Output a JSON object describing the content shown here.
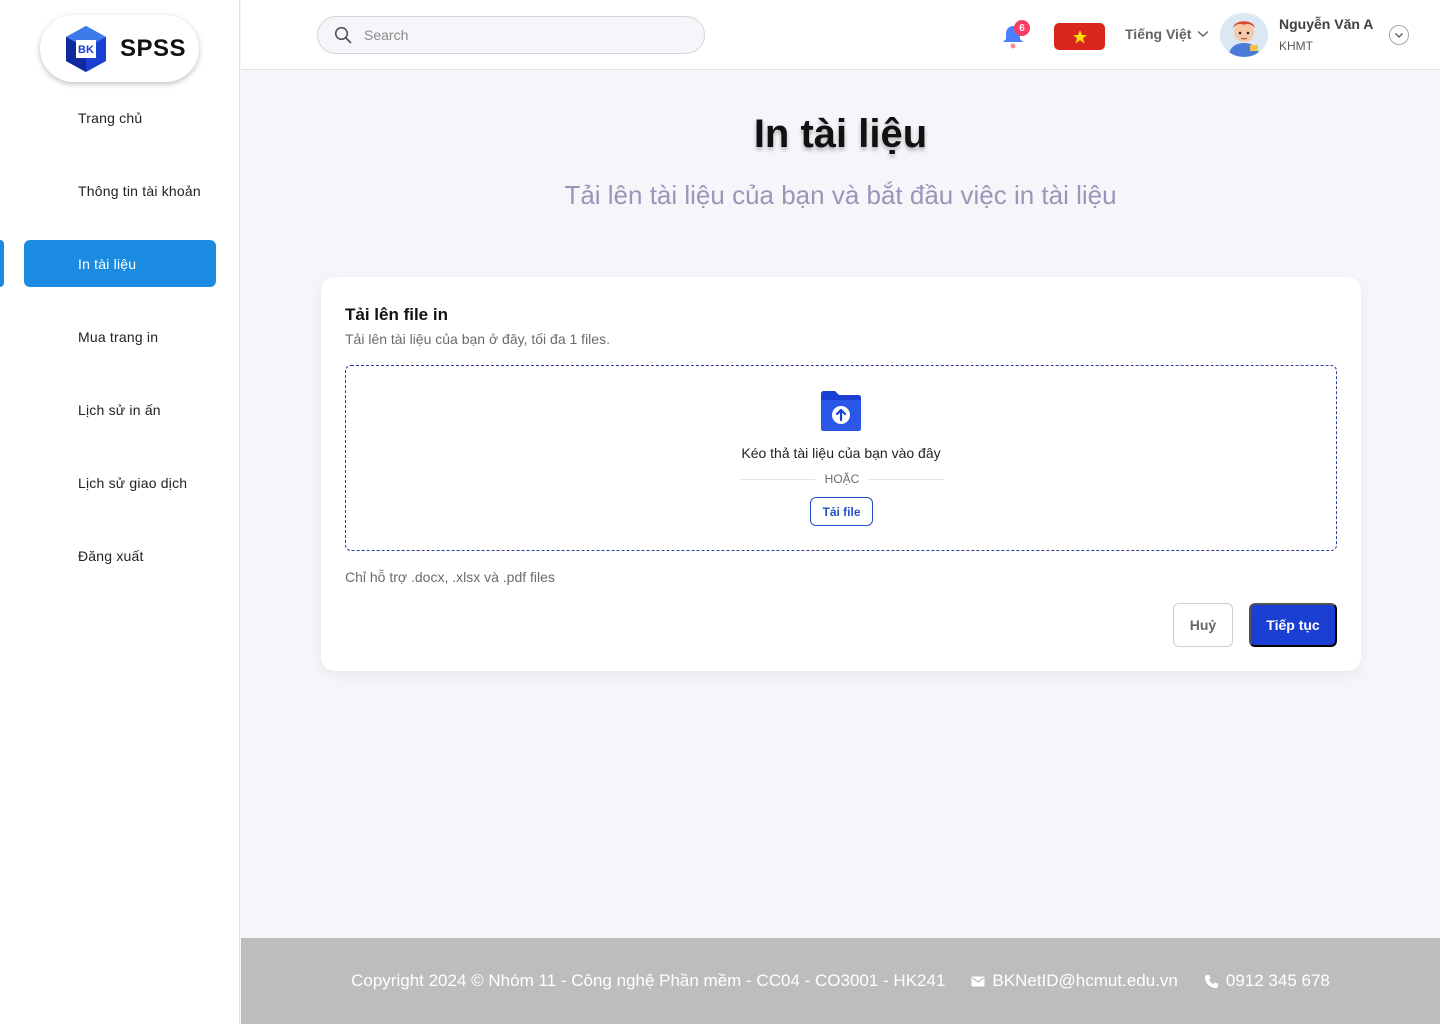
{
  "app": {
    "logo_text": "SPSS",
    "logo_mark_text": "BK"
  },
  "sidebar": {
    "items": [
      {
        "label": "Trang chủ"
      },
      {
        "label": "Thông tin tài khoản"
      },
      {
        "label": "In tài liệu"
      },
      {
        "label": "Mua trang in"
      },
      {
        "label": "Lịch sử in ấn"
      },
      {
        "label": "Lịch sử giao dịch"
      },
      {
        "label": "Đăng xuất"
      }
    ],
    "active_index": 2
  },
  "header": {
    "search_placeholder": "Search",
    "notification_count": "6",
    "language": "Tiếng Việt",
    "user_name": "Nguyễn Văn A",
    "user_role": "KHMT",
    "icons": [
      "search-icon",
      "bell-icon",
      "vietnam-flag-icon",
      "chevron-down-icon",
      "avatar"
    ]
  },
  "main": {
    "title": "In tài liệu",
    "subtitle": "Tải lên tài liệu của bạn và bắt đầu việc in tài liệu"
  },
  "upload_card": {
    "title": "Tải lên file in",
    "description": "Tải lên tài liệu của bạn ở đây, tối đa 1 files.",
    "drop_text": "Kéo thả tài liệu của bạn vào đây",
    "or_text": "HOẶC",
    "upload_button": "Tải file",
    "support_text": "Chỉ hỗ trợ .docx, .xlsx và .pdf files",
    "cancel_button": "Huỷ",
    "continue_button": "Tiếp tục"
  },
  "footer": {
    "copyright": "Copyright 2024 © Nhóm 11 - Công nghệ Phần mềm - CC04 - CO3001 - HK241",
    "email": "BKNetID@hcmut.edu.vn",
    "phone": "0912 345 678"
  },
  "colors": {
    "accent": "#1a8be0",
    "primary_button": "#1b3fd2",
    "badge": "#f93c65",
    "flag_red": "#da251d",
    "footer_bg": "#bdbdbd"
  }
}
